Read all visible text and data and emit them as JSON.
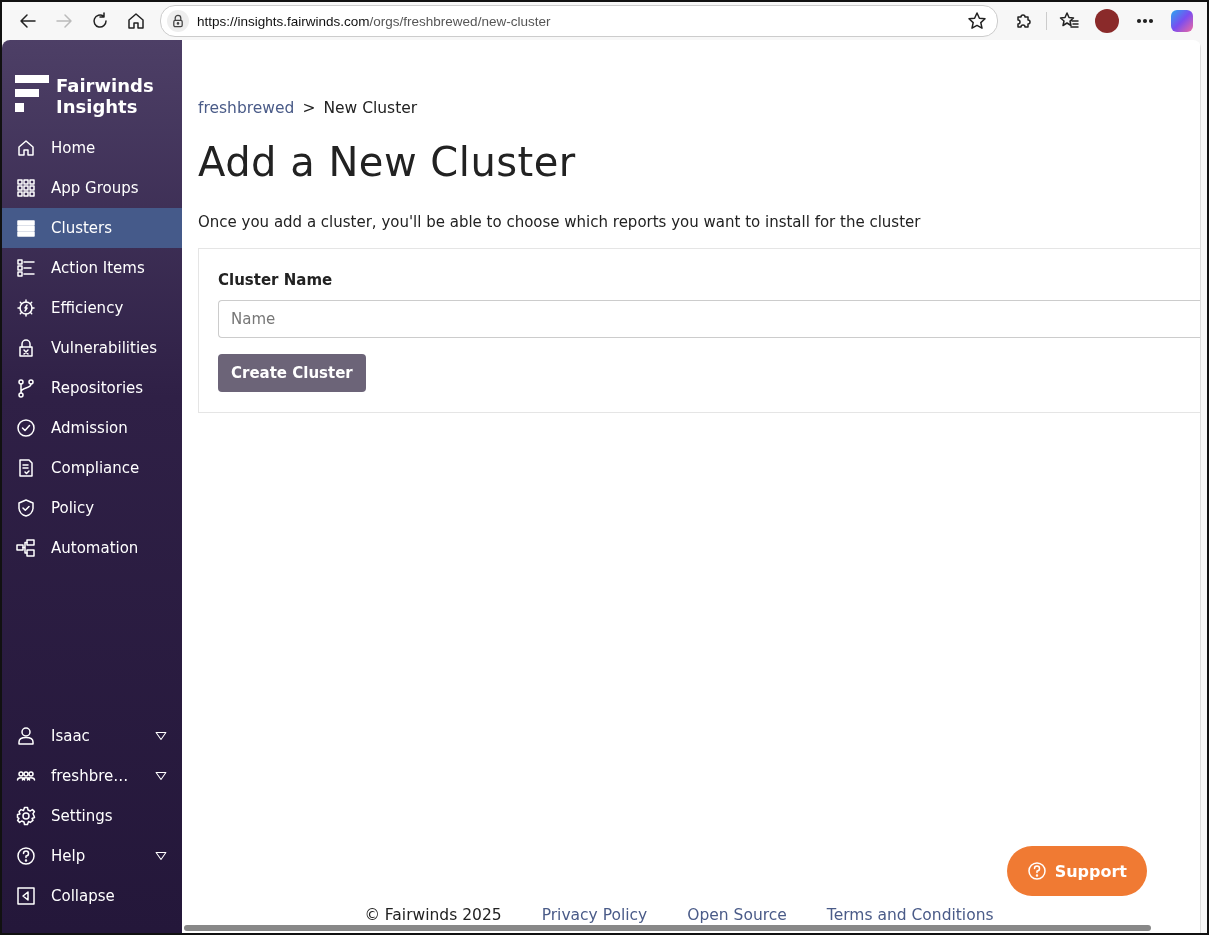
{
  "browser": {
    "url_host": "https://insights.fairwinds.com",
    "url_path": "/orgs/freshbrewed/new-cluster"
  },
  "sidebar": {
    "logo_line_1": "Fairwinds",
    "logo_line_2": "Insights",
    "items": [
      {
        "label": "Home",
        "selected": false
      },
      {
        "label": "App Groups",
        "selected": false
      },
      {
        "label": "Clusters",
        "selected": true
      },
      {
        "label": "Action Items",
        "selected": false
      },
      {
        "label": "Efficiency",
        "selected": false
      },
      {
        "label": "Vulnerabilities",
        "selected": false
      },
      {
        "label": "Repositories",
        "selected": false
      },
      {
        "label": "Admission",
        "selected": false
      },
      {
        "label": "Compliance",
        "selected": false
      },
      {
        "label": "Policy",
        "selected": false
      },
      {
        "label": "Automation",
        "selected": false
      }
    ],
    "bottom_items": [
      {
        "label": "Isaac",
        "dropdown": true
      },
      {
        "label": "freshbre…",
        "dropdown": true
      },
      {
        "label": "Settings",
        "dropdown": false
      },
      {
        "label": "Help",
        "dropdown": true
      },
      {
        "label": "Collapse",
        "dropdown": false
      }
    ]
  },
  "breadcrumb": [
    {
      "label": "freshbrewed",
      "kind": "link"
    },
    {
      "label": "New Cluster",
      "kind": "current"
    }
  ],
  "breadcrumb_separator": ">",
  "title": "Add a New Cluster",
  "description": "Once you add a cluster, you'll be able to choose which reports you want to install for the cluster",
  "form": {
    "field_label": "Cluster Name",
    "placeholder": "Name",
    "button": "Create Cluster"
  },
  "support_button": "Support",
  "footer": {
    "copyright": "© Fairwinds 2025",
    "links": [
      "Privacy Policy",
      "Open Source",
      "Terms and Conditions"
    ]
  }
}
